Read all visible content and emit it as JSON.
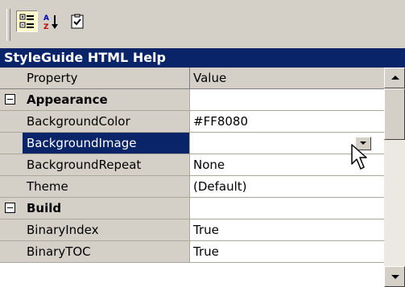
{
  "toolbar": {
    "buttons": [
      {
        "icon": "categorized-icon",
        "pressed": true
      },
      {
        "icon": "alphabetical-sort-icon",
        "pressed": false
      },
      {
        "icon": "property-pages-icon",
        "pressed": false
      }
    ]
  },
  "title": "StyleGuide HTML Help",
  "grid": {
    "headers": {
      "property": "Property",
      "value": "Value"
    },
    "categories": [
      {
        "name": "Appearance",
        "expanded": true,
        "rows": [
          {
            "name": "BackgroundColor",
            "value": "#FF8080"
          },
          {
            "name": "BackgroundImage",
            "value": "",
            "selected": true
          },
          {
            "name": "BackgroundRepeat",
            "value": "None"
          },
          {
            "name": "Theme",
            "value": "(Default)"
          }
        ]
      },
      {
        "name": "Build",
        "expanded": true,
        "rows": [
          {
            "name": "BinaryIndex",
            "value": "True"
          },
          {
            "name": "BinaryTOC",
            "value": "True"
          }
        ]
      }
    ]
  },
  "colors": {
    "selection": "#0a246a",
    "title_bar": "#0a246a",
    "face": "#d4d0c8",
    "highlight_button": "#fff8c8"
  }
}
